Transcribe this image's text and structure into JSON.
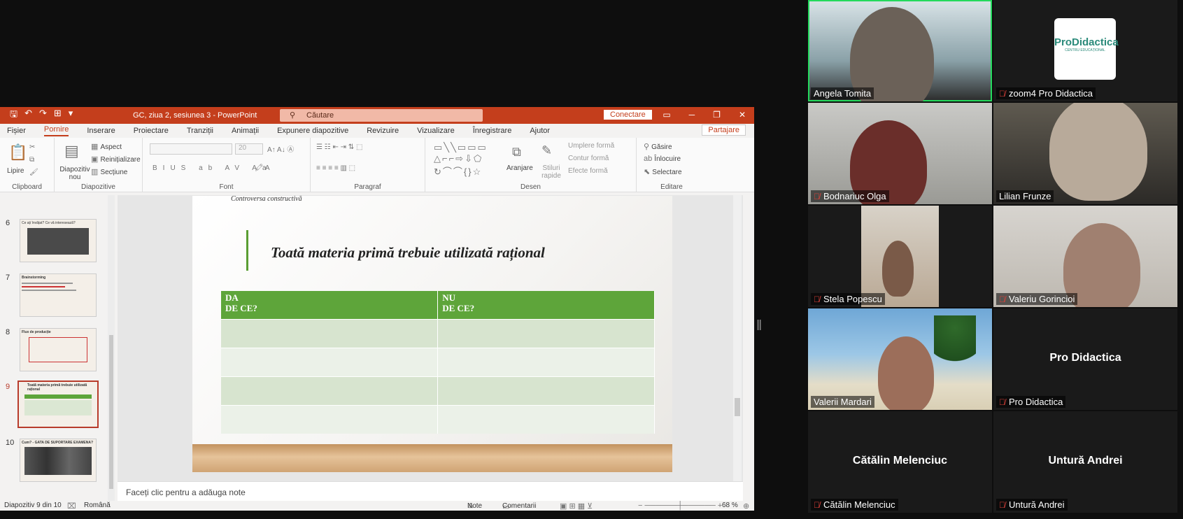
{
  "powerpoint": {
    "doc_title": "GC, ziua 2, sesiunea 3  -  PowerPoint",
    "search_placeholder": "Căutare",
    "connect_label": "Conectare",
    "share_label": "Partajare",
    "tabs": [
      "Fișier",
      "Pornire",
      "Inserare",
      "Proiectare",
      "Tranziții",
      "Animații",
      "Expunere diapozitive",
      "Revizuire",
      "Vizualizare",
      "Înregistrare",
      "Ajutor"
    ],
    "ribbon": {
      "clipboard": {
        "label": "Clipboard",
        "paste": "Lipire"
      },
      "slides": {
        "label": "Diapozitive",
        "new_slide": "Diapozitiv nou",
        "layout": "Aspect",
        "reset": "Reinițializare",
        "section": "Secțiune"
      },
      "font": {
        "label": "Font",
        "size": "20"
      },
      "paragraph": {
        "label": "Paragraf"
      },
      "drawing": {
        "label": "Desen",
        "arrange": "Aranjare",
        "quick_styles": "Stiluri rapide",
        "fill": "Umplere formă",
        "outline": "Contur formă",
        "effects": "Efecte formă"
      },
      "editing": {
        "label": "Editare",
        "find": "Găsire",
        "replace": "Înlocuire",
        "select": "Selectare"
      }
    },
    "thumbnails": [
      {
        "num": "6",
        "title": "Ce ați învățat? Ce vă interesează?"
      },
      {
        "num": "7",
        "title": "Brainstorming"
      },
      {
        "num": "8",
        "title": "Flux de producție"
      },
      {
        "num": "9",
        "title": "Toată materia primă trebuie utilizată rațional"
      },
      {
        "num": "10",
        "title": "Cum? - GATA DE SUPORTARE EXAMENA?"
      }
    ],
    "slide": {
      "header": "Controversa constructivă",
      "title": "Toată materia primă trebuie utilizată rațional",
      "col1_line1": "DA",
      "col1_line2": "DE CE?",
      "col2_line1": "NU",
      "col2_line2": "DE CE?"
    },
    "notes_placeholder": "Faceți clic pentru a adăuga note",
    "status": {
      "slide_info": "Diapozitiv 9 din 10",
      "language": "Română",
      "notes": "Note",
      "comments": "Comentarii",
      "zoom": "68 %"
    }
  },
  "zoom_gallery": {
    "participants": [
      {
        "name": "Angela Tomita",
        "muted": false,
        "video": true,
        "active": true
      },
      {
        "name": "zoom4 Pro Didactica",
        "muted": true,
        "video": true,
        "logo": "ProDidactica",
        "logo_sub": "CENTRU EDUCAȚIONAL"
      },
      {
        "name": "Bodnariuc Olga",
        "muted": true,
        "video": true
      },
      {
        "name": "Lilian Frunze",
        "muted": false,
        "video": true
      },
      {
        "name": "Stela Popescu",
        "muted": true,
        "video": true
      },
      {
        "name": "Valeriu Gorincioi",
        "muted": true,
        "video": true
      },
      {
        "name": "Valerii Mardari",
        "muted": false,
        "video": true
      },
      {
        "name": "Pro Didactica",
        "muted": true,
        "video": false,
        "display": "Pro Didactica"
      },
      {
        "name": "Cătălin Melenciuc",
        "muted": true,
        "video": false,
        "display": "Cătălin Melenciuc"
      },
      {
        "name": "Untură Andrei",
        "muted": true,
        "video": false,
        "display": "Untură Andrei"
      }
    ]
  }
}
